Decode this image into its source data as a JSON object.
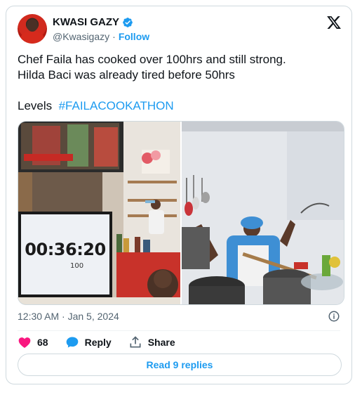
{
  "author": {
    "name": "KWASI GAZY",
    "handle": "@Kwasigazy",
    "separator": "·",
    "follow_label": "Follow"
  },
  "tweet": {
    "line1": "Chef Faila has cooked over 100hrs and still strong.",
    "line2": "Hilda Baci was already tired before 50hrs",
    "line3_prefix": "Levels",
    "hashtag": "#FAILACOOKATHON"
  },
  "media": {
    "timer_display": "00:36:20",
    "timer_sub": "100"
  },
  "timestamp": "12:30 AM · Jan 5, 2024",
  "actions": {
    "like_count": "68",
    "reply_label": "Reply",
    "share_label": "Share"
  },
  "read_replies_label": "Read 9 replies",
  "colors": {
    "accent": "#1d9bf0",
    "like": "#f91880",
    "text": "#0f1419",
    "muted": "#536471"
  }
}
